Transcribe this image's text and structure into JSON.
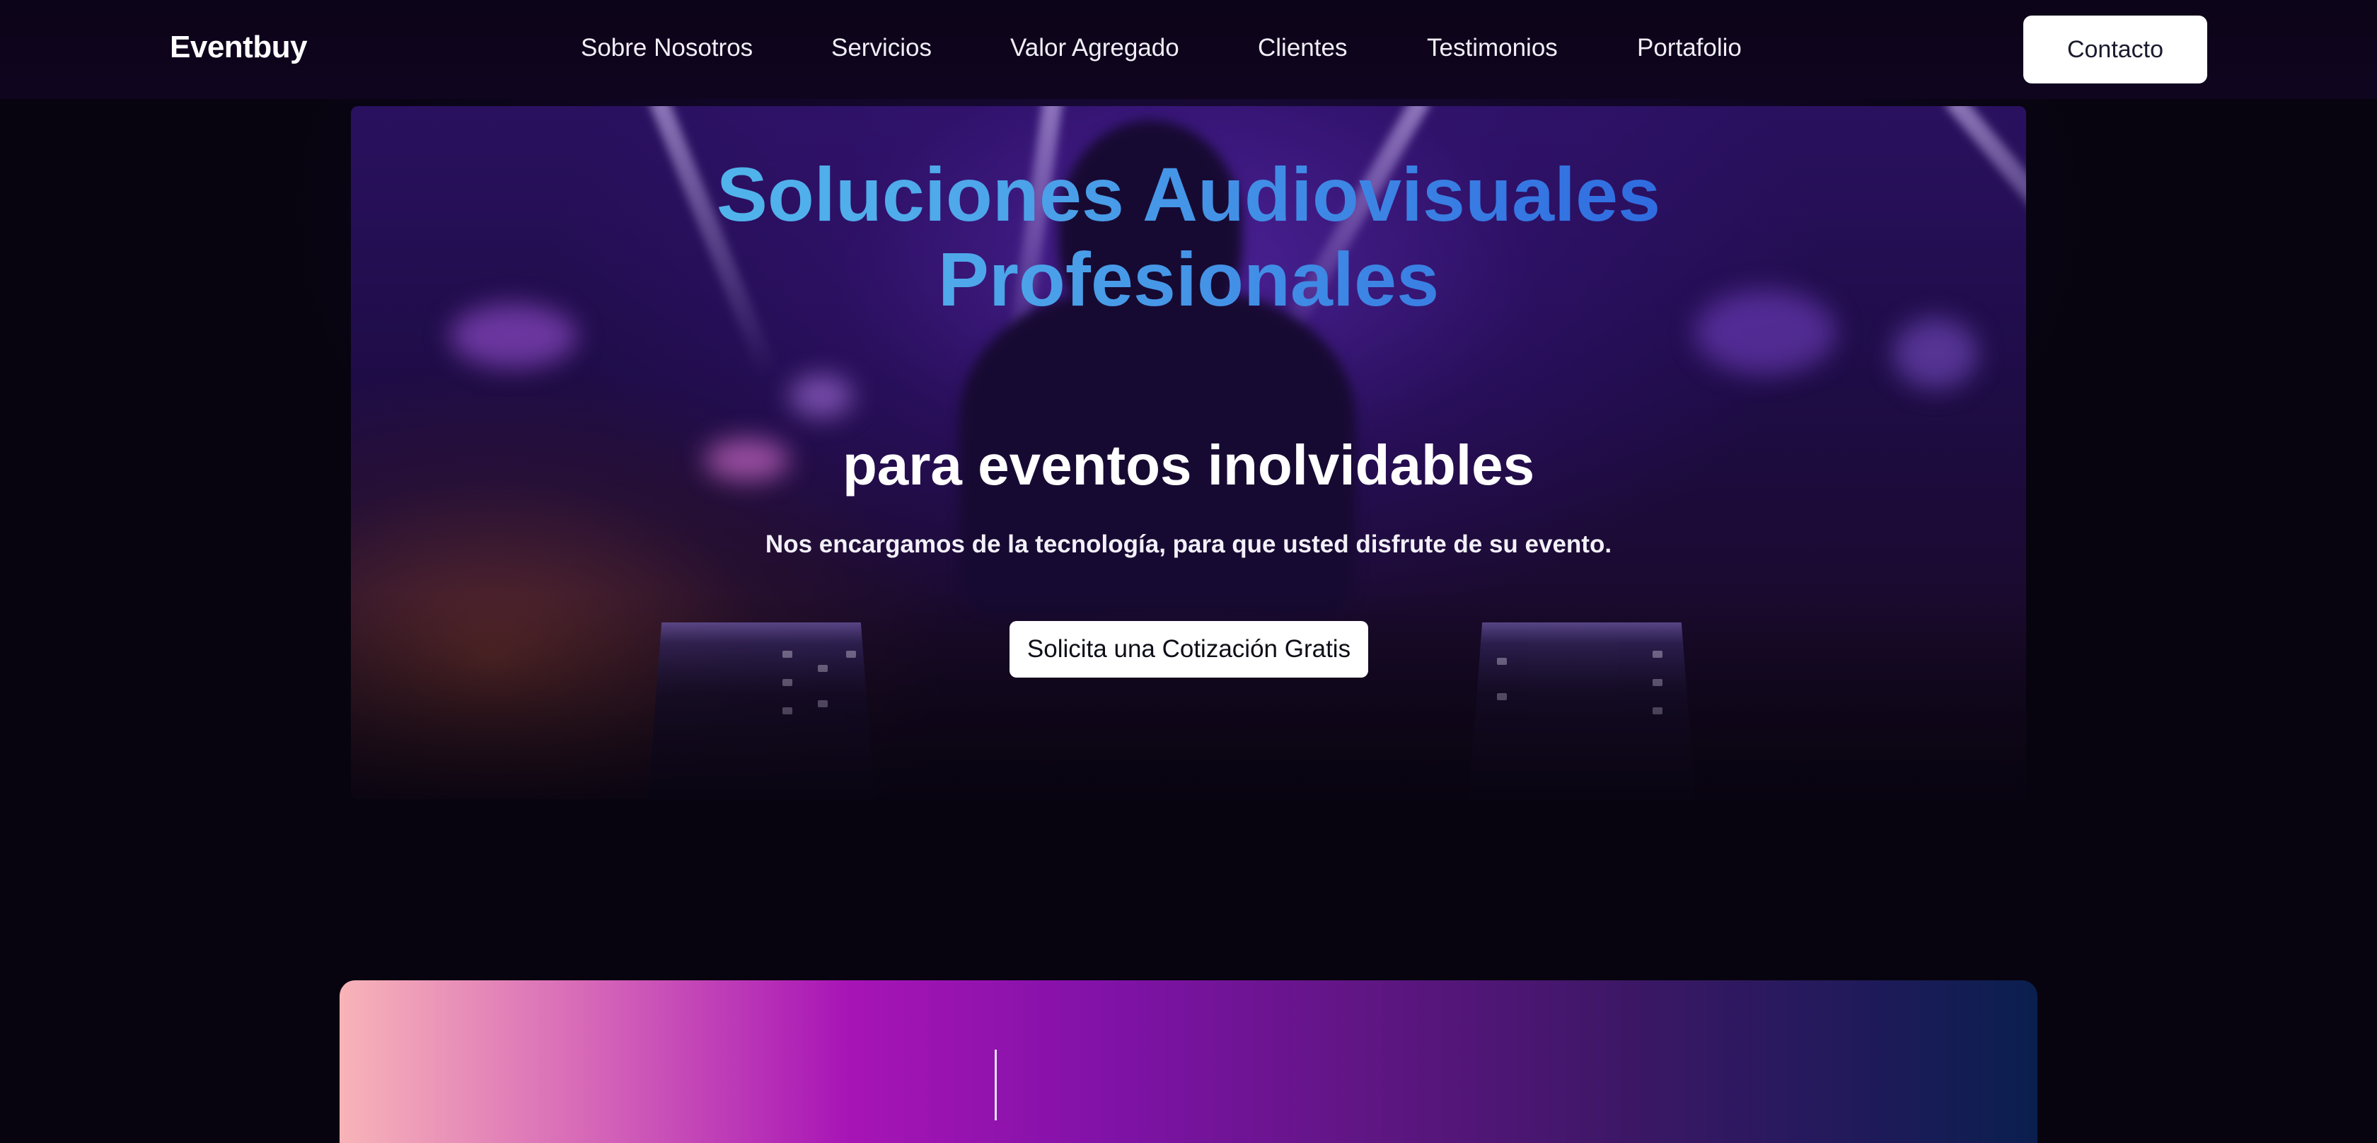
{
  "navbar": {
    "logo": "Eventbuy",
    "links": [
      {
        "label": "Sobre Nosotros"
      },
      {
        "label": "Servicios"
      },
      {
        "label": "Valor Agregado"
      },
      {
        "label": "Clientes"
      },
      {
        "label": "Testimonios"
      },
      {
        "label": "Portafolio"
      }
    ],
    "contact_label": "Contacto"
  },
  "hero": {
    "title_line1": "Soluciones Audiovisuales",
    "title_line2": "Profesionales",
    "subtitle": "para eventos inolvidables",
    "description": "Nos encargamos de la tecnología, para que usted disfrute de su evento.",
    "cta_label": "Solicita una Cotización Gratis",
    "title_gradient": [
      "#55d4f0",
      "#2446d8"
    ]
  },
  "band": {
    "gradient": [
      "#f8b4b8",
      "#a714b6",
      "#5c1680",
      "#0a1f4e"
    ]
  }
}
